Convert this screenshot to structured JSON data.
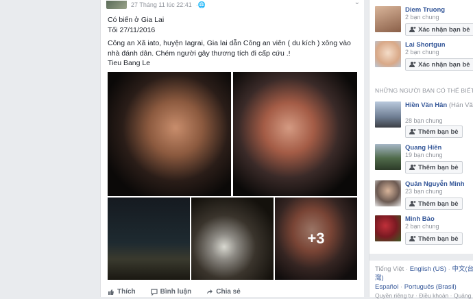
{
  "post": {
    "timestamp": "27 Tháng 11 lúc 22:41",
    "globe_glyph": "·🌐",
    "chevron_glyph": "⌄",
    "title": "Có biến ở Gia Lai",
    "subtitle": "Tối 27/11/2016",
    "body_line": "Công an Xã iato, huyện Iagrai, Gia lai dẫn Công an viên ( du kích ) xông vào nhà đánh dân. Chém người gây thương tích đi cấp cứu .!",
    "author_line": "Tieu Bang Le",
    "photo_more_count": "+3",
    "actions": {
      "like": "Thích",
      "comment": "Bình luận",
      "share": "Chia sẻ"
    }
  },
  "sidebar": {
    "requests": [
      {
        "name": "Diem Truong",
        "mutual": "2 bạn chung",
        "button": "Xác nhận bạn bè",
        "avatar_color": "#b58b6e"
      },
      {
        "name": "Lai Shortgun",
        "mutual": "2 bạn chung",
        "button": "Xác nhận bạn bè",
        "avatar_color": "#e6c7b0"
      }
    ],
    "section_title": "NHỮNG NGƯỜI BẠN CÓ THỂ BIẾT",
    "suggestions": [
      {
        "name": "Hiền Văn Hân",
        "alt_name": "(Hán Văn Hiền)",
        "mutual": "28 bạn chung",
        "button": "Thêm bạn bè",
        "avatar_color": "#6e7d92"
      },
      {
        "name": "Quang Hiền",
        "mutual": "19 bạn chung",
        "button": "Thêm bạn bè",
        "avatar_color": "#4f6a4a"
      },
      {
        "name": "Quân Nguyễn Minh",
        "mutual": "23 bạn chung",
        "button": "Thêm bạn bè",
        "avatar_color": "#6c5a52"
      },
      {
        "name": "Minh Bảo",
        "mutual": "2 bạn chung",
        "button": "Thêm bạn bè",
        "avatar_color": "#7a1a22"
      }
    ],
    "languages": {
      "line1": [
        "Tiếng Việt",
        "English (US)",
        "中文(台灣)"
      ],
      "line2": [
        "Español",
        "Português (Brasil)"
      ]
    },
    "footer_text": "Quyền riêng tư · Điều khoản · Quảng"
  },
  "colors": {
    "link": "#365899",
    "muted": "#90949c",
    "page_bg": "#e9ebee"
  }
}
